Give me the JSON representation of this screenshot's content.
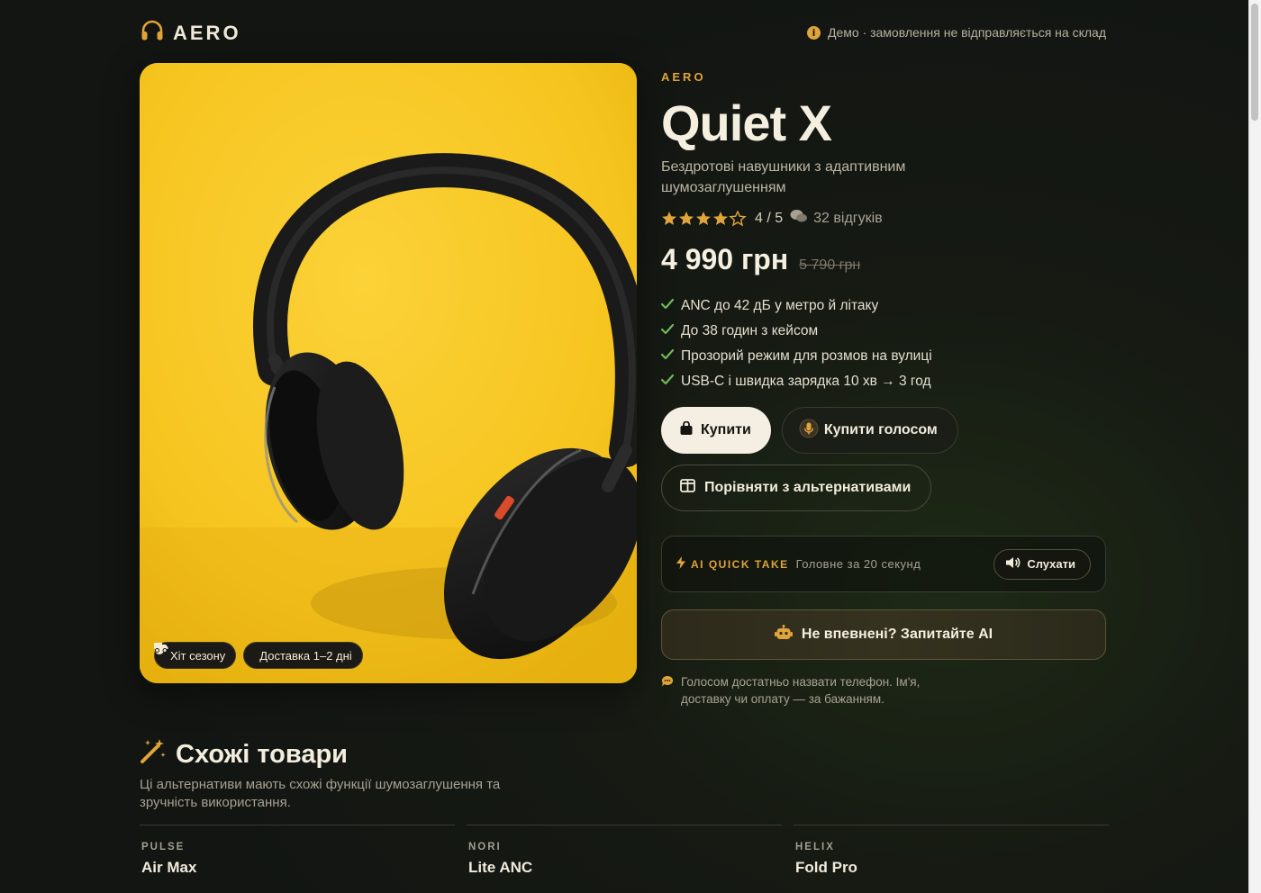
{
  "header": {
    "logo_text": "AERO",
    "demo_note": "Демо · замовлення не відправляється на склад"
  },
  "hero": {
    "badges": [
      {
        "icon": "fire-icon",
        "label": "Хіт сезону"
      },
      {
        "icon": "truck-icon",
        "label": "Доставка 1–2 дні"
      }
    ]
  },
  "product": {
    "brand": "AERO",
    "title": "Quiet X",
    "subtitle": "Бездротові навушники з адаптивним шумозаглушенням",
    "rating": {
      "value": 4,
      "max": 5,
      "label": "4 / 5",
      "reviews": "32 відгуків"
    },
    "price": "4 990 грн",
    "old_price": "5 790 грн",
    "features": [
      "ANC до 42 дБ у метро й літаку",
      "До 38 годин з кейсом",
      "Прозорий режим для розмов на вулиці",
      "USB-C і швидка зарядка 10 хв → 3 год"
    ],
    "buy_label": "Купити",
    "voice_buy_label": "Купити голосом",
    "compare_label": "Порівняти з альтернативами"
  },
  "ai_take": {
    "label": "AI QUICK TAKE",
    "sub": "Головне за 20 секунд",
    "listen_label": "Слухати"
  },
  "ask_ai": {
    "label": "Не впевнені? Запитайте AI"
  },
  "voice_note": "Голосом достатньо назвати телефон. Ім'я, доставку чи оплату — за бажанням.",
  "similar": {
    "title": "Схожі товари",
    "description": "Ці альтернативи мають схожі функції шумозаглушення та зручність використання.",
    "items": [
      {
        "brand": "PULSE",
        "name": "Air Max"
      },
      {
        "brand": "NORI",
        "name": "Lite ANC"
      },
      {
        "brand": "HELIX",
        "name": "Fold Pro"
      }
    ]
  },
  "colors": {
    "accent": "#e0a43a",
    "background": "#151813",
    "check": "#6fb85a",
    "hero_bg": "#f7c623"
  }
}
